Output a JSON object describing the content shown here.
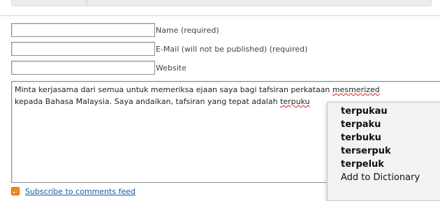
{
  "form": {
    "name_label": "Name (required)",
    "email_label": "E-Mail (will not be published) (required)",
    "website_label": "Website",
    "name_value": "",
    "email_value": "",
    "website_value": ""
  },
  "comment": {
    "line1_before": "Minta kerjasama dari semua untuk memeriksa ejaan saya bagi tafsiran perkataan ",
    "line1_misspelled": "mesmerized",
    "line2_before": "kepada Bahasa Malaysia. Saya andaikan, tafsiran yang tepat adalah ",
    "line2_misspelled": "terpuku"
  },
  "spell_menu": {
    "suggestions": [
      "terpukau",
      "terpaku",
      "terbuku",
      "terserpuk",
      "terpeluk"
    ],
    "add_to_dictionary": "Add to Dictionary"
  },
  "feed": {
    "label": "Subscribe to comments feed",
    "icon": "rss-icon"
  },
  "colors": {
    "misspelling_underline": "#d02020",
    "feed_icon": "#f08a1c",
    "link": "#1a5aa8"
  }
}
